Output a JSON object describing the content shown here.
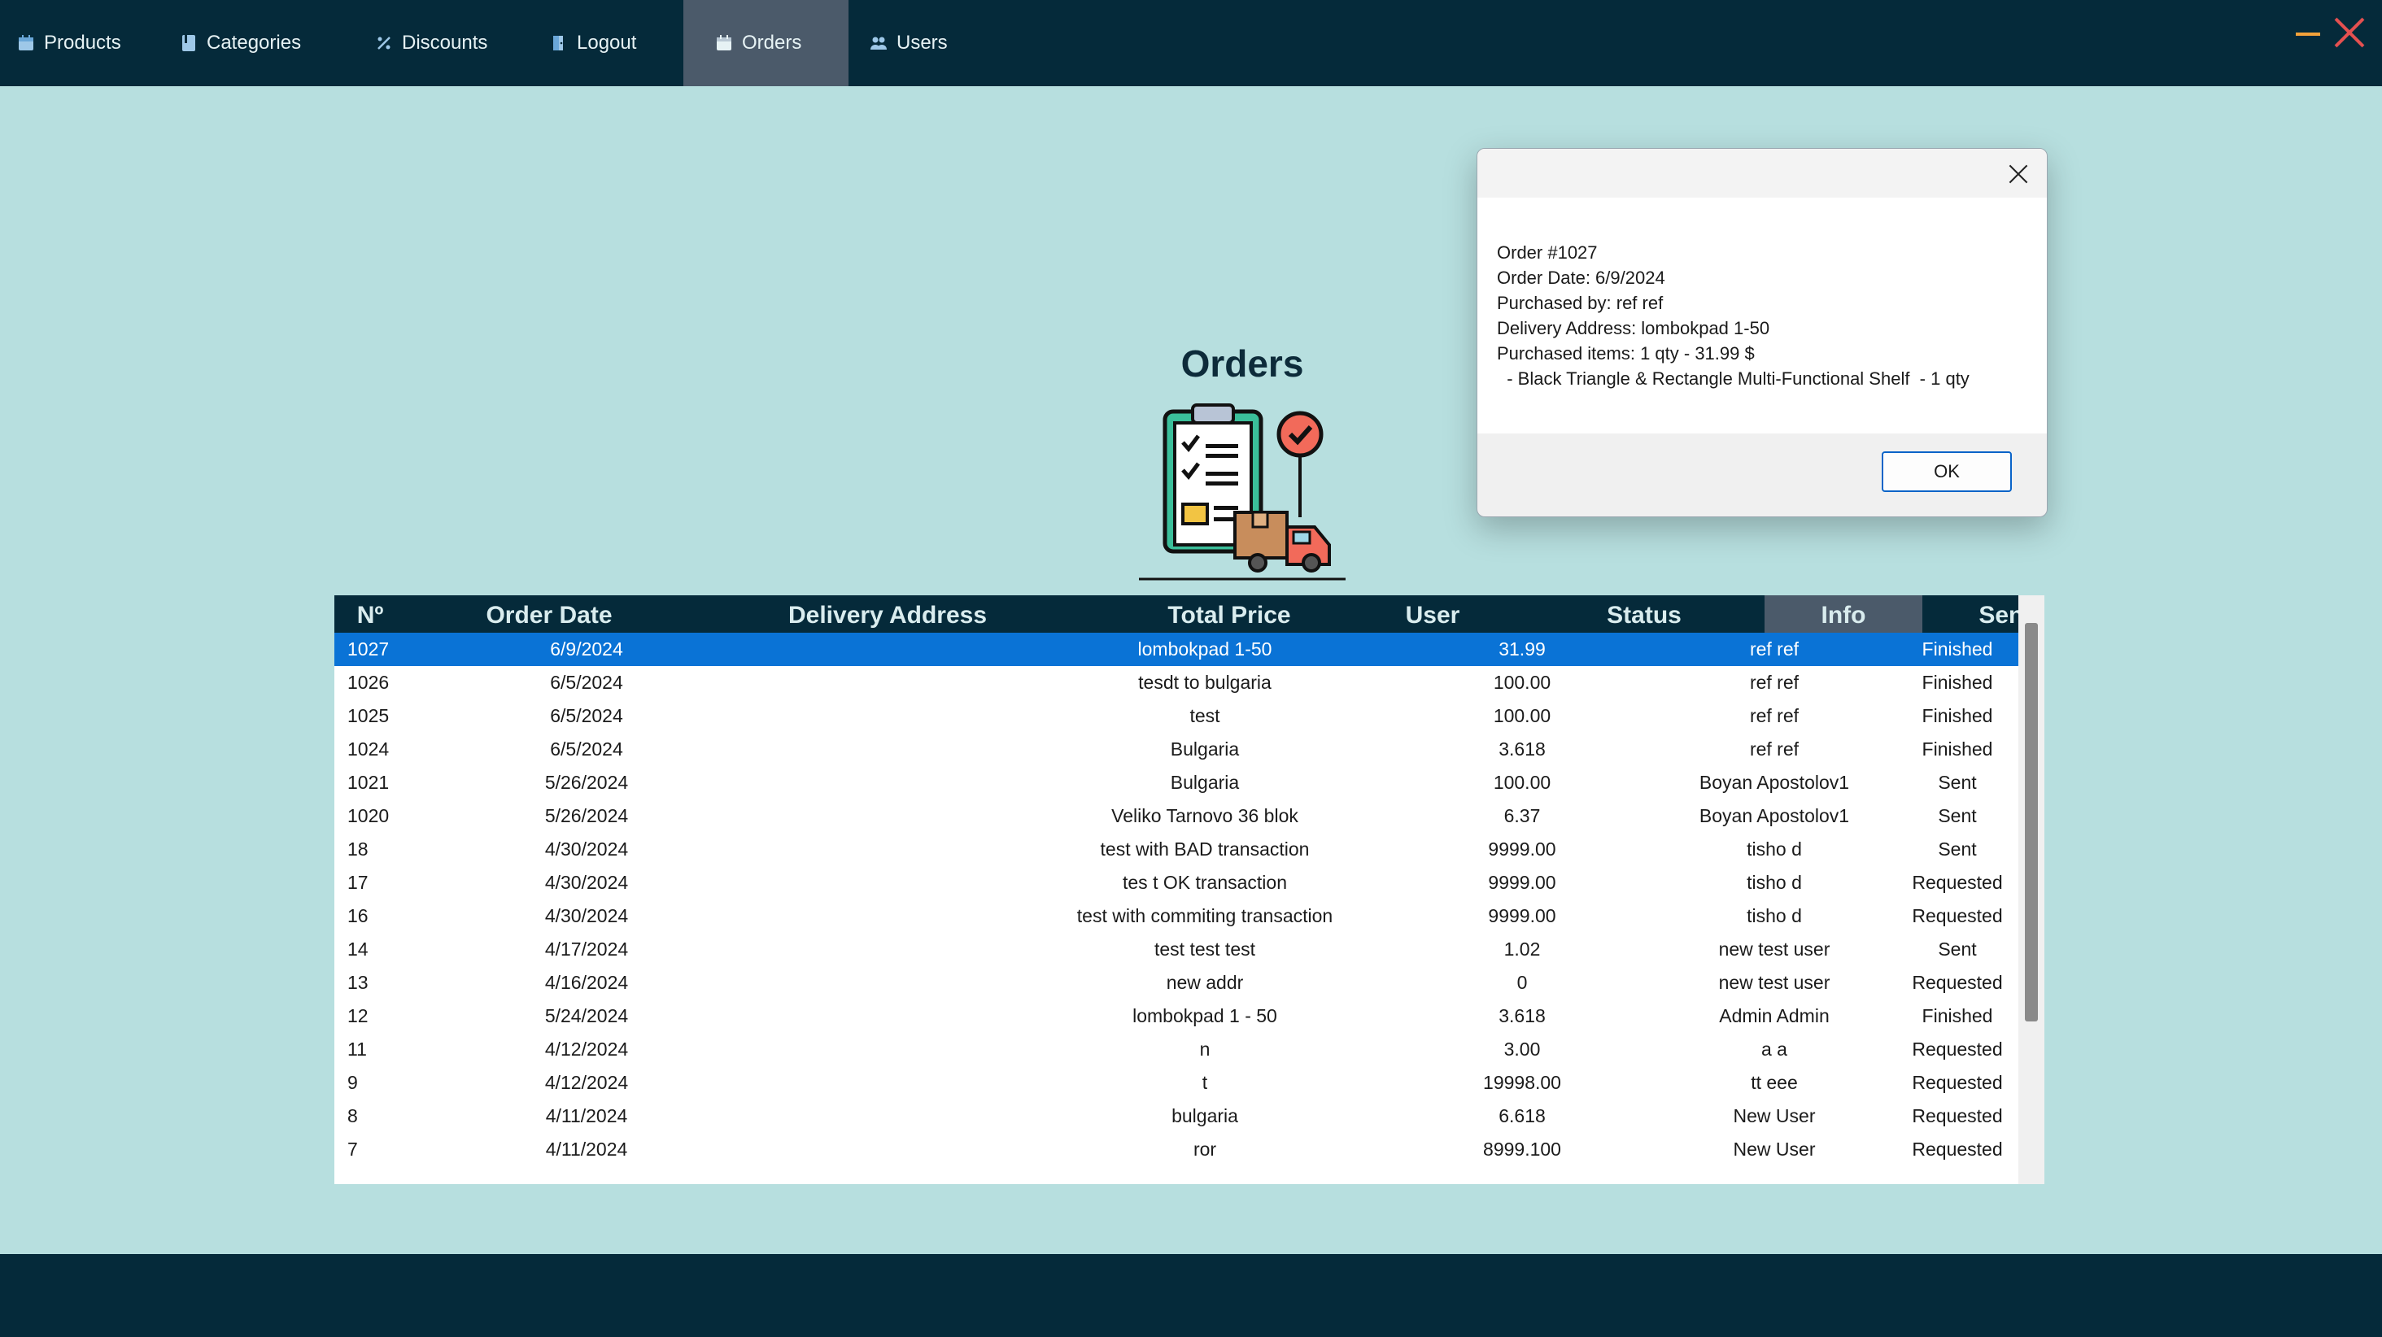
{
  "nav": {
    "items": [
      {
        "label": "Products",
        "icon": "calendar-icon"
      },
      {
        "label": "Categories",
        "icon": "book-icon"
      },
      {
        "label": "Discounts",
        "icon": "percent-icon"
      },
      {
        "label": "Logout",
        "icon": "door-icon"
      },
      {
        "label": "Orders",
        "icon": "calendar-icon",
        "active": true
      },
      {
        "label": "Users",
        "icon": "users-icon"
      }
    ]
  },
  "colors": {
    "background": "#b7dfdf",
    "nav_bg": "#052a3a",
    "nav_active": "#4b5a6a",
    "selected_row": "#0a73d6",
    "minimize": "#f4a23a",
    "close": "#e45050"
  },
  "page": {
    "title": "Orders"
  },
  "table": {
    "columns": [
      "Nº",
      "Order Date",
      "Delivery Address",
      "Total Price",
      "User",
      "Status",
      "Info",
      "Send"
    ],
    "rows": [
      {
        "no": "1027",
        "date": "6/9/2024",
        "address": "lombokpad 1-50",
        "price": "31.99",
        "user": "ref ref",
        "status": "Finished",
        "send": false,
        "selected": true
      },
      {
        "no": "1026",
        "date": "6/5/2024",
        "address": "tesdt to bulgaria",
        "price": "100.00",
        "user": "ref ref",
        "status": "Finished",
        "send": false
      },
      {
        "no": "1025",
        "date": "6/5/2024",
        "address": "test",
        "price": "100.00",
        "user": "ref ref",
        "status": "Finished",
        "send": false
      },
      {
        "no": "1024",
        "date": "6/5/2024",
        "address": "Bulgaria",
        "price": "3.618",
        "user": "ref ref",
        "status": "Finished",
        "send": false
      },
      {
        "no": "1021",
        "date": "5/26/2024",
        "address": "Bulgaria",
        "price": "100.00",
        "user": "Boyan Apostolov1",
        "status": "Sent",
        "send": false
      },
      {
        "no": "1020",
        "date": "5/26/2024",
        "address": "Veliko Tarnovo 36 blok",
        "price": "6.37",
        "user": "Boyan Apostolov1",
        "status": "Sent",
        "send": false
      },
      {
        "no": "18",
        "date": "4/30/2024",
        "address": "test with BAD transaction",
        "price": "9999.00",
        "user": "tisho d",
        "status": "Sent",
        "send": false
      },
      {
        "no": "17",
        "date": "4/30/2024",
        "address": "tes t OK transaction",
        "price": "9999.00",
        "user": "tisho d",
        "status": "Requested",
        "send": true
      },
      {
        "no": "16",
        "date": "4/30/2024",
        "address": "test with commiting transaction",
        "price": "9999.00",
        "user": "tisho d",
        "status": "Requested",
        "send": true
      },
      {
        "no": "14",
        "date": "4/17/2024",
        "address": "test test test",
        "price": "1.02",
        "user": "new test user",
        "status": "Sent",
        "send": false
      },
      {
        "no": "13",
        "date": "4/16/2024",
        "address": "new addr",
        "price": "0",
        "user": "new test user",
        "status": "Requested",
        "send": true
      },
      {
        "no": "12",
        "date": "5/24/2024",
        "address": "lombokpad 1 - 50",
        "price": "3.618",
        "user": "Admin Admin",
        "status": "Finished",
        "send": false
      },
      {
        "no": "11",
        "date": "4/12/2024",
        "address": "n",
        "price": "3.00",
        "user": "a a",
        "status": "Requested",
        "send": true
      },
      {
        "no": "9",
        "date": "4/12/2024",
        "address": "t",
        "price": "19998.00",
        "user": "tt eee",
        "status": "Requested",
        "send": true
      },
      {
        "no": "8",
        "date": "4/11/2024",
        "address": "bulgaria",
        "price": "6.618",
        "user": "New User",
        "status": "Requested",
        "send": true
      },
      {
        "no": "7",
        "date": "4/11/2024",
        "address": "ror",
        "price": "8999.100",
        "user": "New User",
        "status": "Requested",
        "send": true
      }
    ]
  },
  "dialog": {
    "lines": [
      "Order #1027",
      "Order Date: 6/9/2024",
      "Purchased by: ref ref",
      "Delivery Address: lombokpad 1-50",
      "Purchased items: 1 qty - 31.99 $",
      "  - Black Triangle & Rectangle Multi-Functional Shelf  - 1 qty"
    ],
    "ok_label": "OK"
  }
}
